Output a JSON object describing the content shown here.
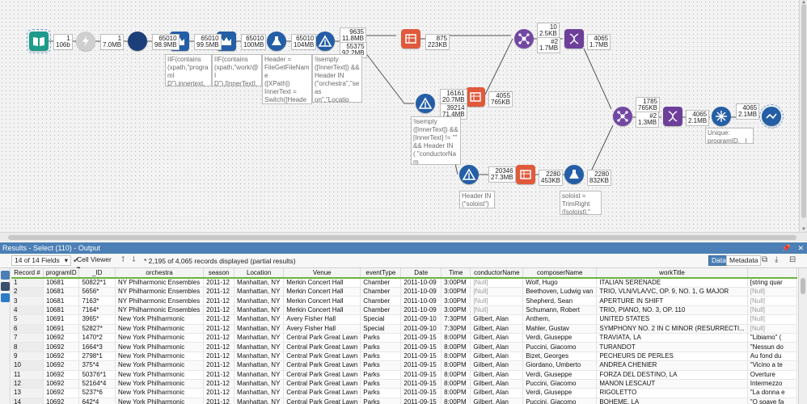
{
  "canvas": {
    "badges": [
      {
        "id": "b1",
        "text": "1\n106b"
      },
      {
        "id": "b2",
        "text": "1\n7.0MB"
      },
      {
        "id": "b3",
        "text": "65010\n98.9MB"
      },
      {
        "id": "b4",
        "text": "65010\n99.5MB"
      },
      {
        "id": "b5",
        "text": "65010\n100MB"
      },
      {
        "id": "b6",
        "text": "65010\n104MB"
      },
      {
        "id": "b7",
        "text": "9635\n11.8MB"
      },
      {
        "id": "b8",
        "text": "55375\n92.2MB"
      },
      {
        "id": "b9",
        "text": "875\n223KB"
      },
      {
        "id": "b10",
        "text": "10\n2.5KB"
      },
      {
        "id": "b11",
        "text": "#2\n1.7MB"
      },
      {
        "id": "b12",
        "text": "4065\n1.7MB"
      },
      {
        "id": "b13",
        "text": "16161\n20.7MB"
      },
      {
        "id": "b14",
        "text": "39214\n71.4MB"
      },
      {
        "id": "b15",
        "text": "4055\n765KB"
      },
      {
        "id": "b16",
        "text": "1785\n765KB"
      },
      {
        "id": "b17",
        "text": "#2\n1.3MB"
      },
      {
        "id": "b18",
        "text": "4065\n2.1MB"
      },
      {
        "id": "b19",
        "text": "4065\n2.1MB"
      },
      {
        "id": "b20",
        "text": "20346\n27.3MB"
      },
      {
        "id": "b21",
        "text": "2280\n453KB"
      },
      {
        "id": "b22",
        "text": "2280\n832KB"
      }
    ],
    "annotations": [
      {
        "id": "a1",
        "text": "IIF(contains\n(xpath,\"programI\nD\"),innertext,\n[Row-1:Program])"
      },
      {
        "id": "a2",
        "text": "IIF(contains\n(xpath,\"work/@I\nD\"),[InnerText],\n[Row-1:Piece])"
      },
      {
        "id": "a3",
        "text": "Header =\nFileGetFileName\n([XPath])\nInnerText =\nSwitch([Header],\n[InnerText],\"soloi..."
      },
      {
        "id": "a4",
        "text": "!isempty\n([InnerText]) &&\nHeader IN\n(\"orchestra\",\"seas\non\",\"Location\",\"V\nenue\",\"eve..."
      },
      {
        "id": "a5",
        "text": "!isempty\n([InnerText]) &&\n[InnerText] != \"\"\n&& Header IN\n( \"conductorNam\ne\",\"compos..."
      },
      {
        "id": "a6",
        "text": "Header IN\n(\"soloist\")"
      },
      {
        "id": "a7",
        "text": "soloist =\nTrimRight\n([soloist],\" +\")"
      },
      {
        "id": "a8",
        "text": "Unique:\nprogramID, _ID"
      }
    ]
  },
  "results": {
    "title": "Results - Select (110) - Output",
    "fields_label": "14 of 14 Fields",
    "viewer_label": "Cell Viewer",
    "records_info": "* 2,195 of 4,065 records displayed (partial results)",
    "tabs": {
      "data": "Data",
      "metadata": "Metadata"
    },
    "columns": [
      "Record #",
      "programID",
      "_ID",
      "orchestra",
      "season",
      "Location",
      "Venue",
      "eventType",
      "Date",
      "Time",
      "conductorName",
      "composerName",
      "workTitle",
      ""
    ],
    "rows": [
      [
        "1",
        "10681",
        "50822*1",
        "NY Philharmonic Ensembles",
        "2011-12",
        "Manhattan, NY",
        "Merkin Concert Hall",
        "Chamber",
        "2011-10-09",
        "3:00PM",
        "[Null]",
        "Wolf,  Hugo",
        "ITALIAN SERENADE",
        "[string quar"
      ],
      [
        "2",
        "10681",
        "5656*",
        "NY Philharmonic Ensembles",
        "2011-12",
        "Manhattan, NY",
        "Merkin Concert Hall",
        "Chamber",
        "2011-10-09",
        "3:00PM",
        "[Null]",
        "Beethoven,  Ludwig  van",
        "TRIO, VLN/VLA/VC, OP.  9, NO. 1, G MAJOR",
        "[Null]"
      ],
      [
        "3",
        "10681",
        "7163*",
        "NY Philharmonic Ensembles",
        "2011-12",
        "Manhattan, NY",
        "Merkin Concert Hall",
        "Chamber",
        "2011-10-09",
        "3:00PM",
        "[Null]",
        "Shepherd,  Sean",
        "APERTURE IN SHIFT",
        "[Null]"
      ],
      [
        "4",
        "10681",
        "7164*",
        "NY Philharmonic Ensembles",
        "2011-12",
        "Manhattan, NY",
        "Merkin Concert Hall",
        "Chamber",
        "2011-10-09",
        "3:00PM",
        "[Null]",
        "Schumann,  Robert",
        "TRIO, PIANO, NO. 3, OP. 110",
        "[Null]"
      ],
      [
        "5",
        "10691",
        "3965*",
        "New York Philharmonic",
        "2011-12",
        "Manhattan, NY",
        "Avery Fisher Hall",
        "Special",
        "2011-09-10",
        "7:30PM",
        "Gilbert,  Alan",
        "Anthem,",
        "UNITED STATES",
        "[Null]"
      ],
      [
        "6",
        "10691",
        "52827*",
        "New York Philharmonic",
        "2011-12",
        "Manhattan, NY",
        "Avery Fisher Hall",
        "Special",
        "2011-09-10",
        "7:30PM",
        "Gilbert,  Alan",
        "Mahler,  Gustav",
        "SYMPHONY NO.  2  IN C MINOR (RESURRECTI...",
        "[Null]"
      ],
      [
        "7",
        "10692",
        "1470*2",
        "New York Philharmonic",
        "2011-12",
        "Manhattan, NY",
        "Central Park Great Lawn",
        "Parks",
        "2011-09-15",
        "8:00PM",
        "Gilbert,  Alan",
        "Verdi,  Giuseppe",
        "TRAVIATA, LA",
        "\"Libiamo\" ("
      ],
      [
        "8",
        "10692",
        "1664*3",
        "New York Philharmonic",
        "2011-12",
        "Manhattan, NY",
        "Central Park Great Lawn",
        "Parks",
        "2011-09-15",
        "8:00PM",
        "Gilbert,  Alan",
        "Puccini,  Giacomo",
        "TURANDOT",
        "\"Nessun do"
      ],
      [
        "9",
        "10692",
        "2798*1",
        "New York Philharmonic",
        "2011-12",
        "Manhattan, NY",
        "Central Park Great Lawn",
        "Parks",
        "2011-09-15",
        "8:00PM",
        "Gilbert,  Alan",
        "Bizet,  Georges",
        "PECHEURS DE PERLES",
        "Au fond du"
      ],
      [
        "10",
        "10692",
        "375*4",
        "New York Philharmonic",
        "2011-12",
        "Manhattan, NY",
        "Central Park Great Lawn",
        "Parks",
        "2011-09-15",
        "8:00PM",
        "Gilbert,  Alan",
        "Giordano,  Umberto",
        "ANDREA CHENIER",
        "\"Vicino a te"
      ],
      [
        "11",
        "10692",
        "50376*1",
        "New York Philharmonic",
        "2011-12",
        "Manhattan, NY",
        "Central Park Great Lawn",
        "Parks",
        "2011-09-15",
        "8:00PM",
        "Gilbert,  Alan",
        "Verdi,  Giuseppe",
        "FORZA DEL DESTINO, LA",
        "Overture"
      ],
      [
        "12",
        "10692",
        "52164*4",
        "New York Philharmonic",
        "2011-12",
        "Manhattan, NY",
        "Central Park Great Lawn",
        "Parks",
        "2011-09-15",
        "8:00PM",
        "Gilbert,  Alan",
        "Puccini,  Giacomo",
        "MANON LESCAUT",
        "Intermezzo"
      ],
      [
        "13",
        "10692",
        "5237*6",
        "New York Philharmonic",
        "2011-12",
        "Manhattan, NY",
        "Central Park Great Lawn",
        "Parks",
        "2011-09-15",
        "8:00PM",
        "Gilbert,  Alan",
        "Verdi,  Giuseppe",
        "RIGOLETTO",
        "\"La donna e"
      ],
      [
        "14",
        "10692",
        "642*4",
        "New York Philharmonic",
        "2011-12",
        "Manhattan, NY",
        "Central Park Great Lawn",
        "Parks",
        "2011-09-15",
        "8:00PM",
        "Gilbert,  Alan",
        "Puccini,  Giacomo",
        "BOHEME, LA",
        "\"O soave fa"
      ]
    ]
  }
}
